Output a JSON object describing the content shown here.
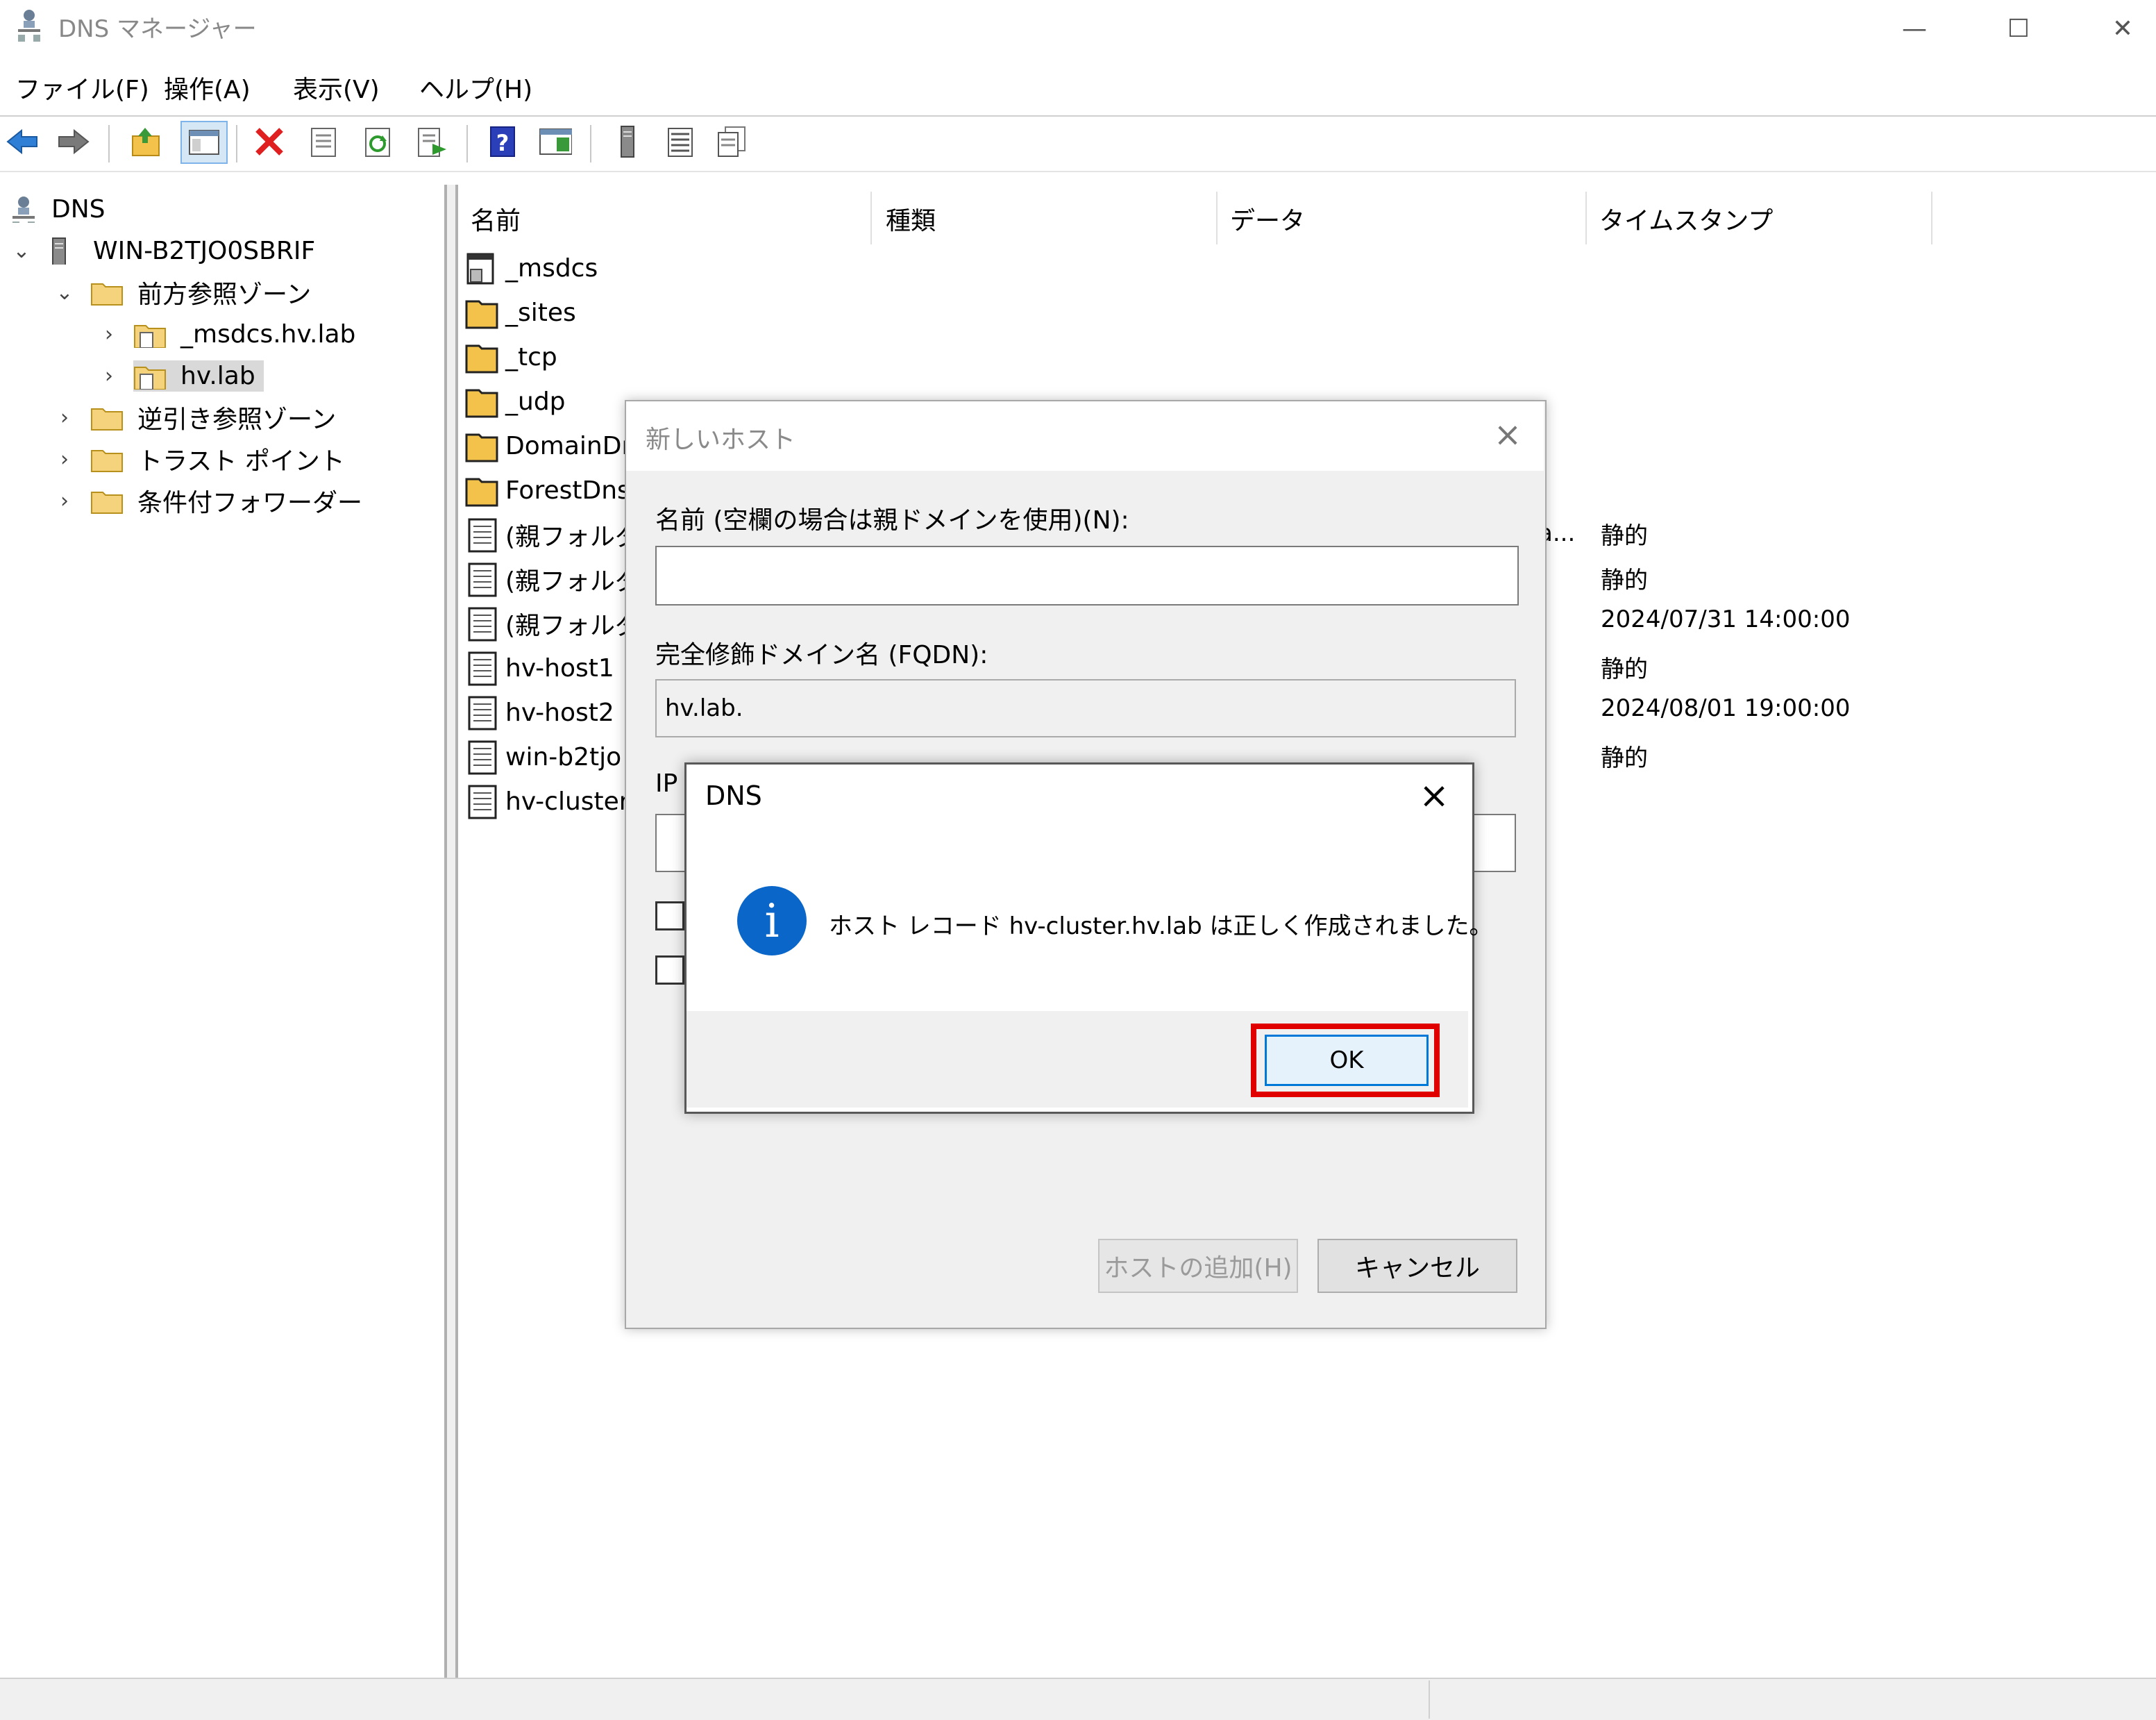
{
  "window": {
    "title": "DNS マネージャー",
    "controls": [
      "—",
      "☐",
      "✕"
    ]
  },
  "menu": [
    "ファイル(F)",
    "操作(A)",
    "表示(V)",
    "ヘルプ(H)"
  ],
  "toolbar": [
    "back-icon",
    "forward-icon",
    "up-folder-icon",
    "show-hide-tree-icon",
    "delete-icon",
    "properties-icon",
    "refresh-icon",
    "export-list-icon",
    "help-icon",
    "console-view-icon",
    "server-icon",
    "list-records-icon",
    "copy-records-icon"
  ],
  "tree": {
    "root": "DNS",
    "server": "WIN-B2TJO0SBRIF",
    "forward_zones": "前方参照ゾーン",
    "zone_msdcs": "_msdcs.hv.lab",
    "zone_hvlab": "hv.lab",
    "reverse_zones": "逆引き参照ゾーン",
    "trust_points": "トラスト ポイント",
    "conditional_forwarders": "条件付フォワーダー"
  },
  "list": {
    "columns": [
      "名前",
      "種類",
      "データ",
      "タイムスタンプ"
    ],
    "rows": [
      {
        "name": "_msdcs"
      },
      {
        "name": "_sites"
      },
      {
        "name": "_tcp"
      },
      {
        "name": "_udp"
      },
      {
        "name": "DomainDı"
      },
      {
        "name": "ForestDns"
      },
      {
        "name": "(親フォルダ",
        "data": "a...",
        "timestamp": "静的"
      },
      {
        "name": "(親フォルダ",
        "timestamp": "静的"
      },
      {
        "name": "(親フォルダ",
        "timestamp": "2024/07/31 14:00:00"
      },
      {
        "name": "hv-host1",
        "timestamp": "静的"
      },
      {
        "name": "hv-host2",
        "timestamp": "2024/08/01 19:00:00"
      },
      {
        "name": "win-b2tjo",
        "timestamp": "静的"
      },
      {
        "name": "hv-cluster"
      }
    ]
  },
  "new_host_dialog": {
    "title": "新しいホスト",
    "name_label": "名前 (空欄の場合は親ドメインを使用)(N):",
    "name_value": "",
    "fqdn_label": "完全修飾ドメイン名 (FQDN):",
    "fqdn_value": "hv.lab.",
    "ip_label": "IP",
    "partial_char": ")",
    "add_host_button": "ホストの追加(H)",
    "cancel_button": "キャンセル"
  },
  "message_box": {
    "title": "DNS",
    "message": "ホスト レコード hv-cluster.hv.lab は正しく作成されました。",
    "ok_button": "OK"
  },
  "colors": {
    "highlight": "#e00000",
    "info_icon": "#0a66c8",
    "ok_border": "#0078d7"
  }
}
